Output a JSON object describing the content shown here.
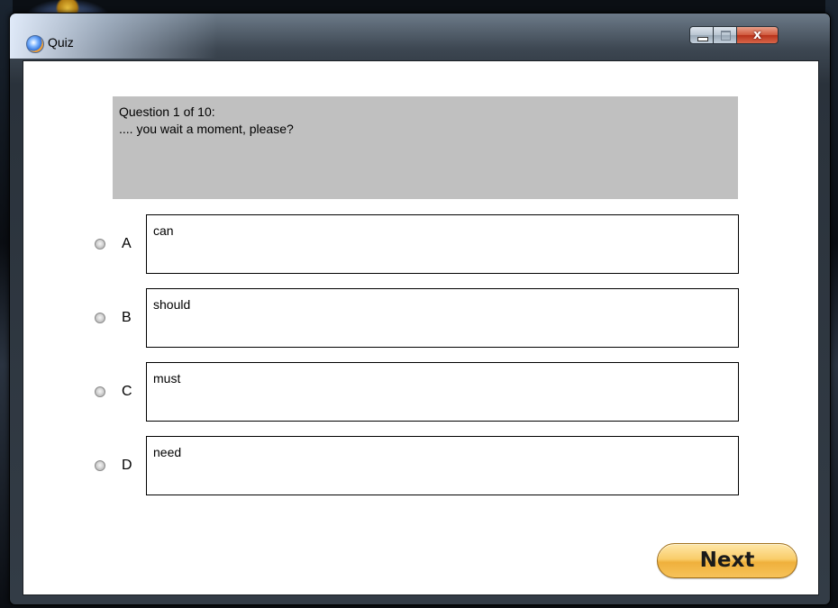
{
  "window": {
    "title": "Quiz",
    "app_icon": "quiz-app-icon",
    "controls": {
      "minimize_icon": "minimize-icon",
      "maximize_icon": "maximize-icon",
      "close_glyph": "x"
    }
  },
  "question": {
    "header": "Question 1 of 10:",
    "text": ".... you wait a moment, please?"
  },
  "options": [
    {
      "letter": "A",
      "text": "can"
    },
    {
      "letter": "B",
      "text": "should"
    },
    {
      "letter": "C",
      "text": "must"
    },
    {
      "letter": "D",
      "text": "need"
    }
  ],
  "next_button": {
    "label": "Next"
  },
  "colors": {
    "question_bg": "#c0c0c0",
    "next_button": "#f9cd6a"
  }
}
